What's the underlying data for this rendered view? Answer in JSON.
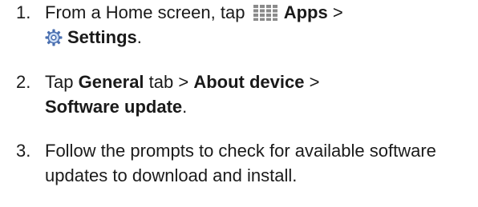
{
  "steps": [
    {
      "number": "1.",
      "line1_text": "From a Home screen, tap",
      "apps_label": "Apps",
      "separator": ">",
      "settings_label": "Settings",
      "period": "."
    },
    {
      "number": "2.",
      "text_tap": "Tap",
      "general_label": "General",
      "text_tab": "tab >",
      "about_label": "About device",
      "separator": ">",
      "software_update_label": "Software update",
      "period": "."
    },
    {
      "number": "3.",
      "text": "Follow the prompts to check for available software updates to download and install."
    }
  ],
  "icons": {
    "apps": "apps-grid-icon",
    "settings": "settings-gear-icon"
  },
  "colors": {
    "text": "#1a1a1a",
    "apps_icon": "#8a8a8a",
    "settings_icon_ring": "#4a6fb0",
    "settings_icon_fill": "#cfe0f7"
  }
}
